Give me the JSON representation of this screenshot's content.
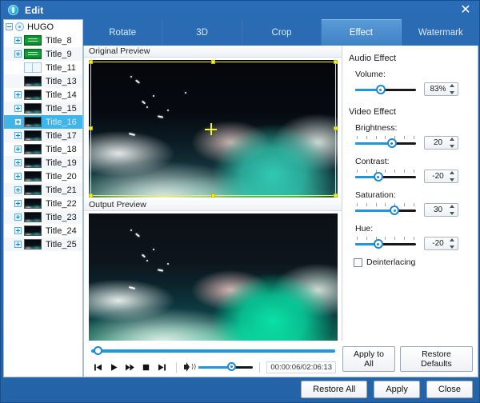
{
  "window": {
    "title": "Edit",
    "icon": "app-circle-icon",
    "close_label": "✕",
    "accent": "#2463a8"
  },
  "tabs": [
    {
      "label": "Rotate",
      "active": false
    },
    {
      "label": "3D",
      "active": false
    },
    {
      "label": "Crop",
      "active": false
    },
    {
      "label": "Effect",
      "active": true
    },
    {
      "label": "Watermark",
      "active": false
    }
  ],
  "tree": {
    "root": {
      "label": "HUGO",
      "expander": "minus",
      "icon": "disc-icon"
    },
    "items": [
      {
        "label": "Title_8",
        "thumb": "green",
        "expander": "plus"
      },
      {
        "label": "Title_9",
        "thumb": "green",
        "expander": "plus"
      },
      {
        "label": "Title_11",
        "thumb": "blank",
        "expander": "none"
      },
      {
        "label": "Title_13",
        "thumb": "sky",
        "expander": "none"
      },
      {
        "label": "Title_14",
        "thumb": "sky",
        "expander": "plus"
      },
      {
        "label": "Title_15",
        "thumb": "sky",
        "expander": "plus"
      },
      {
        "label": "Title_16",
        "thumb": "sky",
        "expander": "plus",
        "selected": true
      },
      {
        "label": "Title_17",
        "thumb": "sky",
        "expander": "plus"
      },
      {
        "label": "Title_18",
        "thumb": "sky",
        "expander": "plus"
      },
      {
        "label": "Title_19",
        "thumb": "sky",
        "expander": "plus"
      },
      {
        "label": "Title_20",
        "thumb": "sky",
        "expander": "plus"
      },
      {
        "label": "Title_21",
        "thumb": "sky",
        "expander": "plus"
      },
      {
        "label": "Title_22",
        "thumb": "sky",
        "expander": "plus"
      },
      {
        "label": "Title_23",
        "thumb": "sky",
        "expander": "plus"
      },
      {
        "label": "Title_24",
        "thumb": "sky",
        "expander": "plus"
      },
      {
        "label": "Title_25",
        "thumb": "sky",
        "expander": "plus"
      }
    ]
  },
  "preview": {
    "original_label": "Original Preview",
    "output_label": "Output Preview",
    "crop_handle_color": "#f6f60a"
  },
  "transport": {
    "prev_icon": "skip-previous-icon",
    "play_icon": "play-icon",
    "forward_icon": "fast-forward-icon",
    "stop_icon": "stop-icon",
    "next_icon": "skip-next-icon",
    "volume_icon": "speaker-icon",
    "timecode": "00:00:06/02:06:13",
    "seek_percent": 1,
    "volume_percent": 50
  },
  "effects": {
    "audio_group": "Audio Effect",
    "video_group": "Video Effect",
    "controls": [
      {
        "label": "Volume:",
        "value": "83%",
        "percent": 42,
        "ticks": false
      },
      {
        "label": "Brightness:",
        "value": "20",
        "percent": 60,
        "ticks": true
      },
      {
        "label": "Contrast:",
        "value": "-20",
        "percent": 38,
        "ticks": true
      },
      {
        "label": "Saturation:",
        "value": "30",
        "percent": 65,
        "ticks": true
      },
      {
        "label": "Hue:",
        "value": "-20",
        "percent": 38,
        "ticks": true
      }
    ],
    "deinterlacing_label": "Deinterlacing",
    "deinterlacing_checked": false,
    "apply_to_all_label": "Apply to All",
    "restore_defaults_label": "Restore Defaults"
  },
  "footer": {
    "restore_all_label": "Restore All",
    "apply_label": "Apply",
    "close_label": "Close"
  }
}
